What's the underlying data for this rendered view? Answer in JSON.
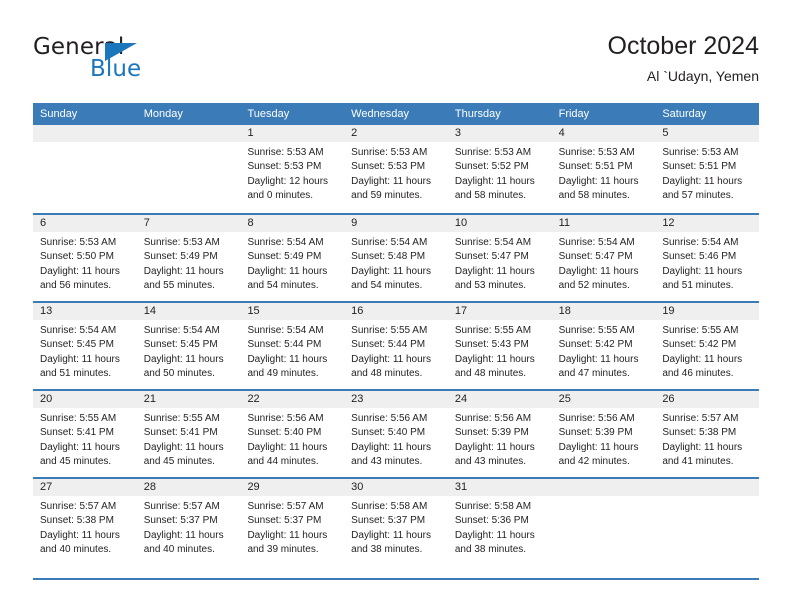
{
  "brand": {
    "name_part1": "General",
    "name_part2": "Blue",
    "triangle_icon": "triangle-icon",
    "accent_color": "#1b76bc"
  },
  "header": {
    "title": "October 2024",
    "location": "Al `Udayn, Yemen"
  },
  "calendar": {
    "header_bg_color": "#3b7cb8",
    "day_band_color": "#efefef",
    "weekdays": [
      "Sunday",
      "Monday",
      "Tuesday",
      "Wednesday",
      "Thursday",
      "Friday",
      "Saturday"
    ],
    "weeks": [
      [
        {
          "day": "",
          "sunrise": "",
          "sunset": "",
          "daylight1": "",
          "daylight2": "",
          "empty": true
        },
        {
          "day": "",
          "sunrise": "",
          "sunset": "",
          "daylight1": "",
          "daylight2": "",
          "empty": true
        },
        {
          "day": "1",
          "sunrise": "Sunrise: 5:53 AM",
          "sunset": "Sunset: 5:53 PM",
          "daylight1": "Daylight: 12 hours",
          "daylight2": "and 0 minutes."
        },
        {
          "day": "2",
          "sunrise": "Sunrise: 5:53 AM",
          "sunset": "Sunset: 5:53 PM",
          "daylight1": "Daylight: 11 hours",
          "daylight2": "and 59 minutes."
        },
        {
          "day": "3",
          "sunrise": "Sunrise: 5:53 AM",
          "sunset": "Sunset: 5:52 PM",
          "daylight1": "Daylight: 11 hours",
          "daylight2": "and 58 minutes."
        },
        {
          "day": "4",
          "sunrise": "Sunrise: 5:53 AM",
          "sunset": "Sunset: 5:51 PM",
          "daylight1": "Daylight: 11 hours",
          "daylight2": "and 58 minutes."
        },
        {
          "day": "5",
          "sunrise": "Sunrise: 5:53 AM",
          "sunset": "Sunset: 5:51 PM",
          "daylight1": "Daylight: 11 hours",
          "daylight2": "and 57 minutes."
        }
      ],
      [
        {
          "day": "6",
          "sunrise": "Sunrise: 5:53 AM",
          "sunset": "Sunset: 5:50 PM",
          "daylight1": "Daylight: 11 hours",
          "daylight2": "and 56 minutes."
        },
        {
          "day": "7",
          "sunrise": "Sunrise: 5:53 AM",
          "sunset": "Sunset: 5:49 PM",
          "daylight1": "Daylight: 11 hours",
          "daylight2": "and 55 minutes."
        },
        {
          "day": "8",
          "sunrise": "Sunrise: 5:54 AM",
          "sunset": "Sunset: 5:49 PM",
          "daylight1": "Daylight: 11 hours",
          "daylight2": "and 54 minutes."
        },
        {
          "day": "9",
          "sunrise": "Sunrise: 5:54 AM",
          "sunset": "Sunset: 5:48 PM",
          "daylight1": "Daylight: 11 hours",
          "daylight2": "and 54 minutes."
        },
        {
          "day": "10",
          "sunrise": "Sunrise: 5:54 AM",
          "sunset": "Sunset: 5:47 PM",
          "daylight1": "Daylight: 11 hours",
          "daylight2": "and 53 minutes."
        },
        {
          "day": "11",
          "sunrise": "Sunrise: 5:54 AM",
          "sunset": "Sunset: 5:47 PM",
          "daylight1": "Daylight: 11 hours",
          "daylight2": "and 52 minutes."
        },
        {
          "day": "12",
          "sunrise": "Sunrise: 5:54 AM",
          "sunset": "Sunset: 5:46 PM",
          "daylight1": "Daylight: 11 hours",
          "daylight2": "and 51 minutes."
        }
      ],
      [
        {
          "day": "13",
          "sunrise": "Sunrise: 5:54 AM",
          "sunset": "Sunset: 5:45 PM",
          "daylight1": "Daylight: 11 hours",
          "daylight2": "and 51 minutes."
        },
        {
          "day": "14",
          "sunrise": "Sunrise: 5:54 AM",
          "sunset": "Sunset: 5:45 PM",
          "daylight1": "Daylight: 11 hours",
          "daylight2": "and 50 minutes."
        },
        {
          "day": "15",
          "sunrise": "Sunrise: 5:54 AM",
          "sunset": "Sunset: 5:44 PM",
          "daylight1": "Daylight: 11 hours",
          "daylight2": "and 49 minutes."
        },
        {
          "day": "16",
          "sunrise": "Sunrise: 5:55 AM",
          "sunset": "Sunset: 5:44 PM",
          "daylight1": "Daylight: 11 hours",
          "daylight2": "and 48 minutes."
        },
        {
          "day": "17",
          "sunrise": "Sunrise: 5:55 AM",
          "sunset": "Sunset: 5:43 PM",
          "daylight1": "Daylight: 11 hours",
          "daylight2": "and 48 minutes."
        },
        {
          "day": "18",
          "sunrise": "Sunrise: 5:55 AM",
          "sunset": "Sunset: 5:42 PM",
          "daylight1": "Daylight: 11 hours",
          "daylight2": "and 47 minutes."
        },
        {
          "day": "19",
          "sunrise": "Sunrise: 5:55 AM",
          "sunset": "Sunset: 5:42 PM",
          "daylight1": "Daylight: 11 hours",
          "daylight2": "and 46 minutes."
        }
      ],
      [
        {
          "day": "20",
          "sunrise": "Sunrise: 5:55 AM",
          "sunset": "Sunset: 5:41 PM",
          "daylight1": "Daylight: 11 hours",
          "daylight2": "and 45 minutes."
        },
        {
          "day": "21",
          "sunrise": "Sunrise: 5:55 AM",
          "sunset": "Sunset: 5:41 PM",
          "daylight1": "Daylight: 11 hours",
          "daylight2": "and 45 minutes."
        },
        {
          "day": "22",
          "sunrise": "Sunrise: 5:56 AM",
          "sunset": "Sunset: 5:40 PM",
          "daylight1": "Daylight: 11 hours",
          "daylight2": "and 44 minutes."
        },
        {
          "day": "23",
          "sunrise": "Sunrise: 5:56 AM",
          "sunset": "Sunset: 5:40 PM",
          "daylight1": "Daylight: 11 hours",
          "daylight2": "and 43 minutes."
        },
        {
          "day": "24",
          "sunrise": "Sunrise: 5:56 AM",
          "sunset": "Sunset: 5:39 PM",
          "daylight1": "Daylight: 11 hours",
          "daylight2": "and 43 minutes."
        },
        {
          "day": "25",
          "sunrise": "Sunrise: 5:56 AM",
          "sunset": "Sunset: 5:39 PM",
          "daylight1": "Daylight: 11 hours",
          "daylight2": "and 42 minutes."
        },
        {
          "day": "26",
          "sunrise": "Sunrise: 5:57 AM",
          "sunset": "Sunset: 5:38 PM",
          "daylight1": "Daylight: 11 hours",
          "daylight2": "and 41 minutes."
        }
      ],
      [
        {
          "day": "27",
          "sunrise": "Sunrise: 5:57 AM",
          "sunset": "Sunset: 5:38 PM",
          "daylight1": "Daylight: 11 hours",
          "daylight2": "and 40 minutes."
        },
        {
          "day": "28",
          "sunrise": "Sunrise: 5:57 AM",
          "sunset": "Sunset: 5:37 PM",
          "daylight1": "Daylight: 11 hours",
          "daylight2": "and 40 minutes."
        },
        {
          "day": "29",
          "sunrise": "Sunrise: 5:57 AM",
          "sunset": "Sunset: 5:37 PM",
          "daylight1": "Daylight: 11 hours",
          "daylight2": "and 39 minutes."
        },
        {
          "day": "30",
          "sunrise": "Sunrise: 5:58 AM",
          "sunset": "Sunset: 5:37 PM",
          "daylight1": "Daylight: 11 hours",
          "daylight2": "and 38 minutes."
        },
        {
          "day": "31",
          "sunrise": "Sunrise: 5:58 AM",
          "sunset": "Sunset: 5:36 PM",
          "daylight1": "Daylight: 11 hours",
          "daylight2": "and 38 minutes."
        },
        {
          "day": "",
          "sunrise": "",
          "sunset": "",
          "daylight1": "",
          "daylight2": "",
          "empty": true
        },
        {
          "day": "",
          "sunrise": "",
          "sunset": "",
          "daylight1": "",
          "daylight2": "",
          "empty": true
        }
      ]
    ]
  }
}
